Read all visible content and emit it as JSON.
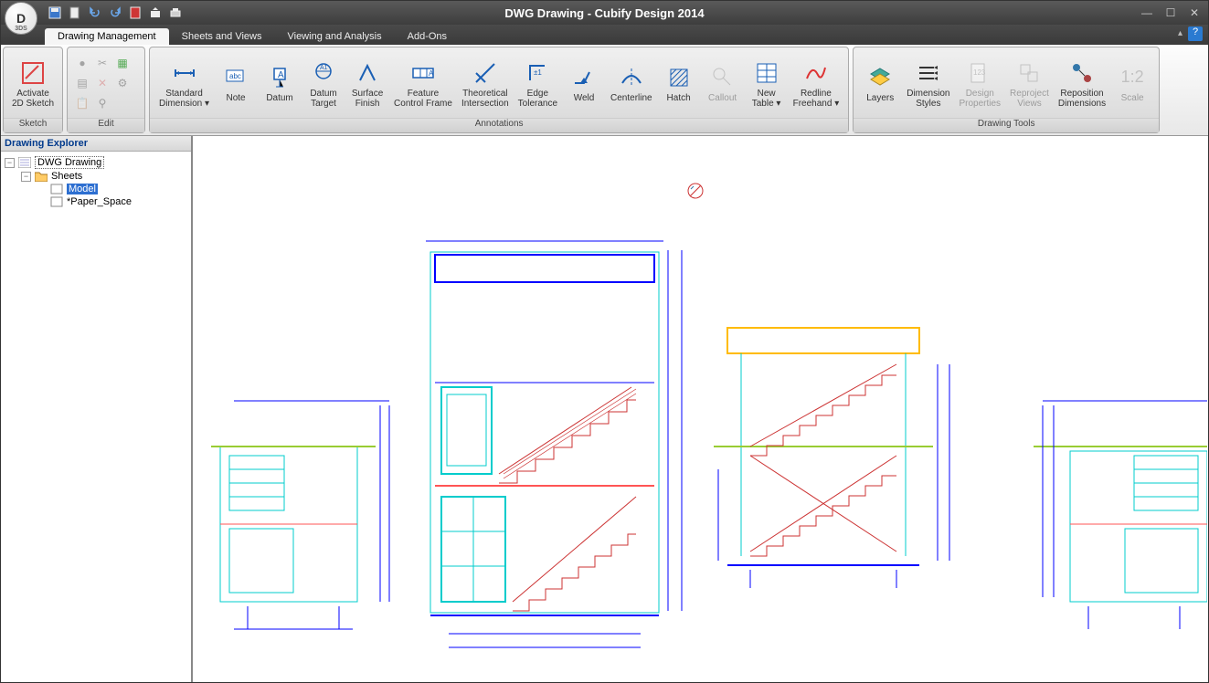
{
  "app": {
    "title": "DWG Drawing - Cubify Design 2014",
    "logo_letter": "D"
  },
  "tabs": {
    "items": [
      {
        "label": "Drawing Management",
        "active": true
      },
      {
        "label": "Sheets and Views",
        "active": false
      },
      {
        "label": "Viewing and Analysis",
        "active": false
      },
      {
        "label": "Add-Ons",
        "active": false
      }
    ]
  },
  "ribbon": {
    "sketch": {
      "label": "Sketch",
      "activate": "Activate\n2D Sketch"
    },
    "edit": {
      "label": "Edit"
    },
    "annotations": {
      "label": "Annotations",
      "items": [
        {
          "label": "Standard\nDimension ▾"
        },
        {
          "label": "Note"
        },
        {
          "label": "Datum"
        },
        {
          "label": "Datum\nTarget"
        },
        {
          "label": "Surface\nFinish"
        },
        {
          "label": "Feature\nControl Frame"
        },
        {
          "label": "Theoretical\nIntersection"
        },
        {
          "label": "Edge\nTolerance"
        },
        {
          "label": "Weld"
        },
        {
          "label": "Centerline"
        },
        {
          "label": "Hatch"
        },
        {
          "label": "Callout",
          "disabled": true
        },
        {
          "label": "New\nTable ▾"
        },
        {
          "label": "Redline\nFreehand ▾"
        }
      ]
    },
    "drawingtools": {
      "label": "Drawing Tools",
      "items": [
        {
          "label": "Layers"
        },
        {
          "label": "Dimension\nStyles"
        },
        {
          "label": "Design\nProperties",
          "disabled": true
        },
        {
          "label": "Reproject\nViews",
          "disabled": true
        },
        {
          "label": "Reposition\nDimensions"
        },
        {
          "label": "Scale",
          "disabled": true
        }
      ]
    }
  },
  "explorer": {
    "title": "Drawing Explorer",
    "root": "DWG Drawing",
    "sheets": "Sheets",
    "model": "Model",
    "paper": "*Paper_Space"
  }
}
